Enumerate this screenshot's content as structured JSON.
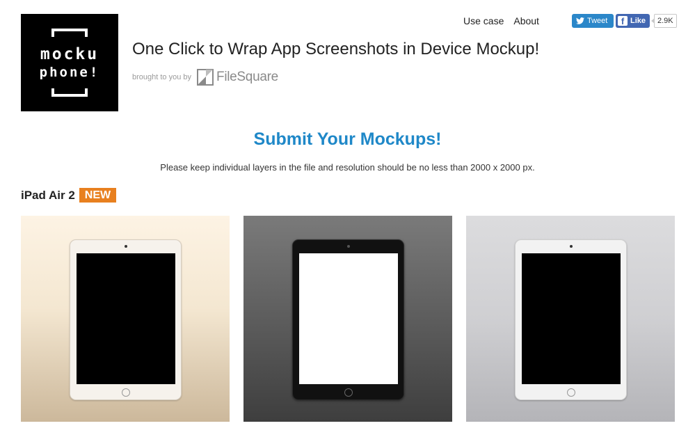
{
  "logo": {
    "line1": "mocku",
    "line2": "phone!"
  },
  "headline": "One Click to Wrap App Screenshots in Device Mockup!",
  "byline": {
    "prefix": "brought to you by",
    "brand": "FileSquare"
  },
  "nav": {
    "use_case": "Use case",
    "about": "About"
  },
  "social": {
    "tweet_label": "Tweet",
    "like_label": "Like",
    "like_count": "2.9K"
  },
  "submit": {
    "title": "Submit Your Mockups!",
    "note": "Please keep individual layers in the file and resolution should be no less than 2000 x 2000 px."
  },
  "section": {
    "title": "iPad Air 2",
    "badge": "NEW"
  },
  "devices": [
    {
      "variant": "gold",
      "icon": "ipad-gold-icon"
    },
    {
      "variant": "space-gray",
      "icon": "ipad-dark-icon"
    },
    {
      "variant": "silver",
      "icon": "ipad-silver-icon"
    }
  ],
  "colors": {
    "accent": "#1f88c8",
    "badge": "#e8801f",
    "tweet": "#2b87c9",
    "facebook": "#4267b2"
  }
}
